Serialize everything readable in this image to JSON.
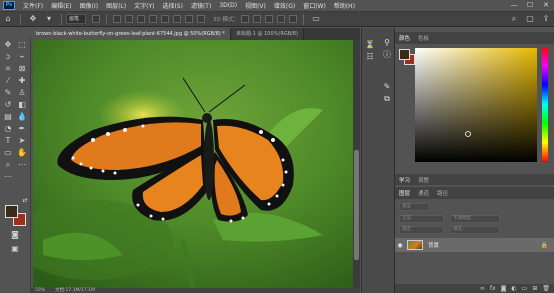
{
  "menubar": {
    "logo": "Ps",
    "items": [
      "文件(F)",
      "编辑(E)",
      "图像(I)",
      "图层(L)",
      "文字(Y)",
      "选择(S)",
      "滤镜(T)",
      "3D(D)",
      "视图(V)",
      "增效(G)",
      "窗口(W)",
      "帮助(H)"
    ],
    "minimize": "—",
    "maximize": "☐",
    "close": "✕"
  },
  "optbar": {
    "sample_label": "画笔",
    "mode_label": "3D 模式："
  },
  "tabs": {
    "active": "brown-black-white-butterfly-on-green-leaf-plant-67544.jpg @ 50%(RGB/8) *",
    "inactive": "未标题-1 @ 100%(RGB/8)"
  },
  "status": {
    "zoom": "50%",
    "doc": "文档:17.1M/17.1M"
  },
  "color_panel": {
    "tab_color": "颜色",
    "tab_swatches": "色板",
    "fg_color": "#3b2a16",
    "bg_color": "#a0301b"
  },
  "learn_panel": {
    "tab_learn": "学习",
    "tab_adjust": "调整"
  },
  "layers_panel": {
    "tab_layers": "图层",
    "tab_channels": "通道",
    "tab_paths": "路径",
    "search_placeholder": "类型",
    "blend_mode": "正常",
    "opacity_label": "不透明度：",
    "fill_label": "填充：",
    "lock_label": "锁定：",
    "layer_name": "背景"
  }
}
